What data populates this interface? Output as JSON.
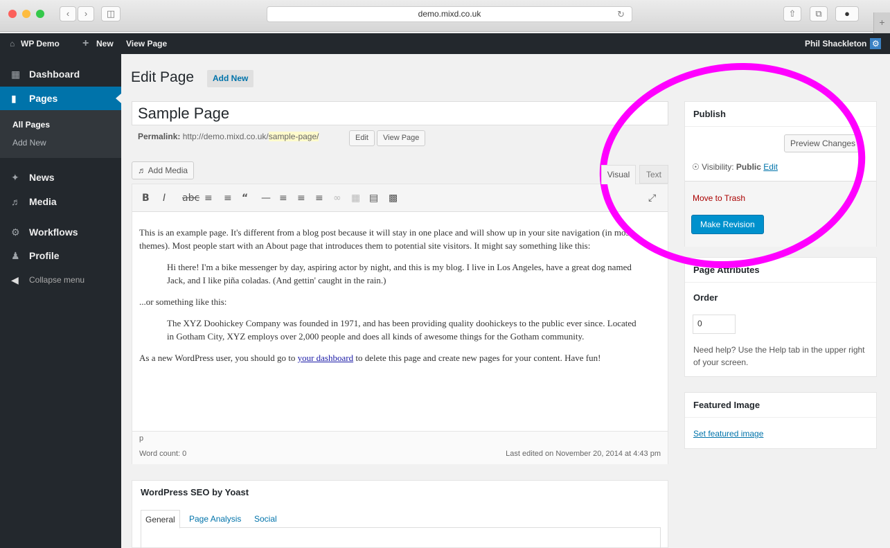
{
  "browser": {
    "url": "demo.mixd.co.uk"
  },
  "adminbar": {
    "site_name": "WP Demo",
    "new_label": "New",
    "view_page": "View Page",
    "user": "Phil Shackleton"
  },
  "sidebar": {
    "items": [
      {
        "label": "Dashboard",
        "icon": "dashboard-icon"
      },
      {
        "label": "Pages",
        "icon": "pages-icon"
      },
      {
        "label": "News",
        "icon": "pin-icon"
      },
      {
        "label": "Media",
        "icon": "media-icon"
      },
      {
        "label": "Workflows",
        "icon": "gear-icon"
      },
      {
        "label": "Profile",
        "icon": "user-icon"
      }
    ],
    "submenu": [
      "All Pages",
      "Add New"
    ],
    "collapse": "Collapse menu"
  },
  "main": {
    "title": "Edit Page",
    "add_new": "Add New",
    "post_title": "Sample Page",
    "permalink_label": "Permalink:",
    "permalink_base": "http://demo.mixd.co.uk/",
    "permalink_slug": "sample-page/",
    "edit_btn": "Edit",
    "view_page_btn": "View Page",
    "add_media": "Add Media",
    "tab_visual": "Visual",
    "tab_text": "Text",
    "content": {
      "p1": "This is an example page. It's different from a blog post because it will stay in one place and will show up in your site navigation (in most themes). Most people start with an About page that introduces them to potential site visitors. It might say something like this:",
      "q1": "Hi there! I'm a bike messenger by day, aspiring actor by night, and this is my blog. I live in Los Angeles, have a great dog named Jack, and I like piña coladas. (And gettin' caught in the rain.)",
      "p2": "...or something like this:",
      "q2": "The XYZ Doohickey Company was founded in 1971, and has been providing quality doohickeys to the public ever since. Located in Gotham City, XYZ employs over 2,000 people and does all kinds of awesome things for the Gotham community.",
      "p3_pre": "As a new WordPress user, you should go to ",
      "p3_link": "your dashboard",
      "p3_post": " to delete this page and create new pages for your content. Have fun!"
    },
    "path": "p",
    "word_count": "Word count: 0",
    "last_edited": "Last edited on November 20, 2014 at 4:43 pm"
  },
  "seo": {
    "title": "WordPress SEO by Yoast",
    "tabs": [
      "General",
      "Page Analysis",
      "Social"
    ]
  },
  "publish": {
    "title": "Publish",
    "preview": "Preview Changes",
    "visibility_label": "Visibility:",
    "visibility_value": "Public",
    "visibility_edit": "Edit",
    "trash": "Move to Trash",
    "make_revision": "Make Revision"
  },
  "attributes": {
    "title": "Page Attributes",
    "order_label": "Order",
    "order_value": "0",
    "help": "Need help? Use the Help tab in the upper right of your screen."
  },
  "featured": {
    "title": "Featured Image",
    "set_link": "Set featured image"
  },
  "colors": {
    "admin_dark": "#23282d",
    "wp_blue": "#0073aa",
    "highlight": "#ff00ff"
  }
}
